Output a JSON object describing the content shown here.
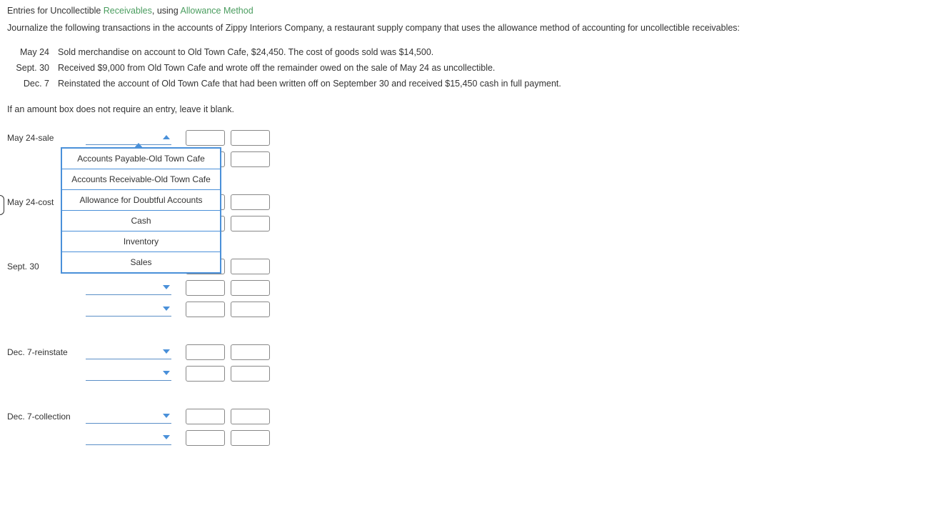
{
  "title": {
    "part1": "Entries for Uncollectible ",
    "link1": "Receivables",
    "part2": ", using ",
    "link2": "Allowance Method"
  },
  "intro": "Journalize the following transactions in the accounts of Zippy Interiors Company, a restaurant supply company that uses the allowance method of accounting for uncollectible receivables:",
  "transactions": [
    {
      "date": "May 24",
      "desc": "Sold merchandise on account to Old Town Cafe, $24,450. The cost of goods sold was $14,500."
    },
    {
      "date": "Sept. 30",
      "desc": "Received $9,000 from Old Town Cafe and wrote off the remainder owed on the sale of May 24 as uncollectible."
    },
    {
      "date": "Dec. 7",
      "desc": "Reinstated the account of Old Town Cafe that had been written off on September 30 and received $15,450 cash in full payment."
    }
  ],
  "note": "If an amount box does not require an entry, leave it blank.",
  "entries": [
    {
      "label": "May 24-sale",
      "lines": 2,
      "open": true
    },
    {
      "label": "May 24-cost",
      "lines": 2
    },
    {
      "label": "Sept. 30",
      "lines": 3
    },
    {
      "label": "Dec. 7-reinstate",
      "lines": 2
    },
    {
      "label": "Dec. 7-collection",
      "lines": 2
    }
  ],
  "dropdown_options": [
    "Accounts Payable-Old Town Cafe",
    "Accounts Receivable-Old Town Cafe",
    "Allowance for Doubtful Accounts",
    "Cash",
    "Inventory",
    "Sales"
  ]
}
